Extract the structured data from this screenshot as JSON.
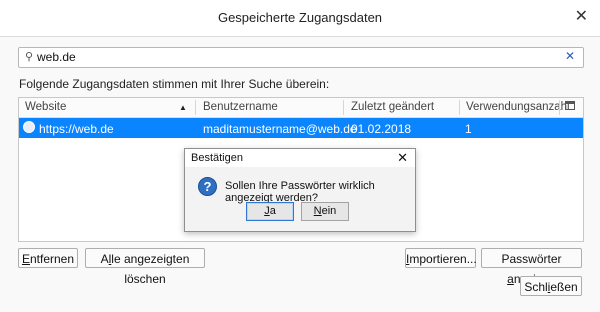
{
  "window": {
    "title": "Gespeicherte Zugangsdaten"
  },
  "search": {
    "value": "web.de"
  },
  "match_label": "Folgende Zugangsdaten stimmen mit Ihrer Suche überein:",
  "table": {
    "columns": [
      "Website",
      "Benutzername",
      "Zuletzt geändert",
      "Verwendungsanzahl"
    ],
    "sort": "Website ascending",
    "rows": [
      {
        "website": "https://web.de",
        "username": "maditamustername@web.de",
        "changed": "01.02.2018",
        "uses": "1",
        "selected": true
      }
    ]
  },
  "buttons": {
    "remove": {
      "pre": "",
      "key": "E",
      "post": "ntfernen"
    },
    "remove_all": {
      "pre": "A",
      "key": "l",
      "post": "le angezeigten löschen"
    },
    "import": {
      "pre": "",
      "key": "I",
      "post": "mportieren..."
    },
    "show_passwords": {
      "pre": "Passwörter ",
      "key": "a",
      "post": "nzeigen"
    },
    "close": {
      "pre": "Schl",
      "key": "i",
      "post": "eßen"
    }
  },
  "dialog": {
    "title": "Bestätigen",
    "message": "Sollen Ihre Passwörter wirklich angezeigt werden?",
    "yes": {
      "key": "J",
      "post": "a"
    },
    "no": {
      "key": "N",
      "post": "ein"
    }
  },
  "colors": {
    "selection": "#0a84ff",
    "dialog_default_border": "#2f77d0",
    "clear_icon": "#2a5db0"
  }
}
